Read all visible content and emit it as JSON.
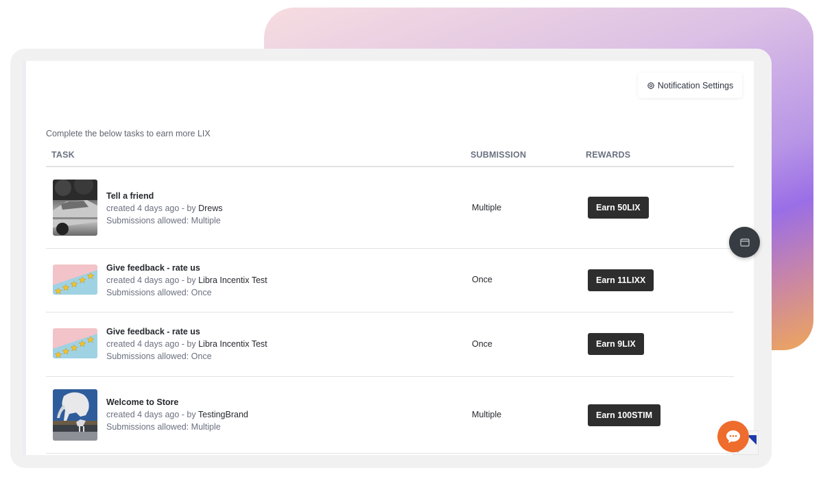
{
  "header": {
    "notification_settings_label": "Notification Settings",
    "notification_icon": "gear-icon"
  },
  "intro_text": "Complete the below tasks to earn more LIX",
  "table": {
    "columns": [
      "TASK",
      "SUBMISSION",
      "REWARDS"
    ],
    "rows": [
      {
        "thumbnail": "car-photo",
        "title": "Tell a friend",
        "created_prefix": "created 4 days ago - by ",
        "author": "Drews",
        "submissions_allowed": "Submissions allowed: Multiple",
        "submission": "Multiple",
        "reward_label": "Earn 50LIX"
      },
      {
        "thumbnail": "five-stars-rating",
        "title": "Give feedback - rate us",
        "created_prefix": "created 4 days ago - by ",
        "author": "Libra Incentix Test",
        "submissions_allowed": "Submissions allowed: Once",
        "submission": "Once",
        "reward_label": "Earn 11LIXX"
      },
      {
        "thumbnail": "five-stars-rating",
        "title": "Give feedback - rate us",
        "created_prefix": "created 4 days ago - by ",
        "author": "Libra Incentix Test",
        "submissions_allowed": "Submissions allowed: Once",
        "submission": "Once",
        "reward_label": "Earn 9LIX"
      },
      {
        "thumbnail": "elephant-statue",
        "title": "Welcome to Store",
        "created_prefix": "created 4 days ago - by ",
        "author": "TestingBrand",
        "submissions_allowed": "Submissions allowed: Multiple",
        "submission": "Multiple",
        "reward_label": "Earn 100STIM"
      }
    ]
  },
  "floating": {
    "side_button_icon": "window-icon",
    "chat_button_icon": "chat-bubble-icon"
  },
  "colors": {
    "earn_button": "#2e2e2e",
    "chat_button": "#ee6c2c",
    "side_button": "#373c42"
  }
}
